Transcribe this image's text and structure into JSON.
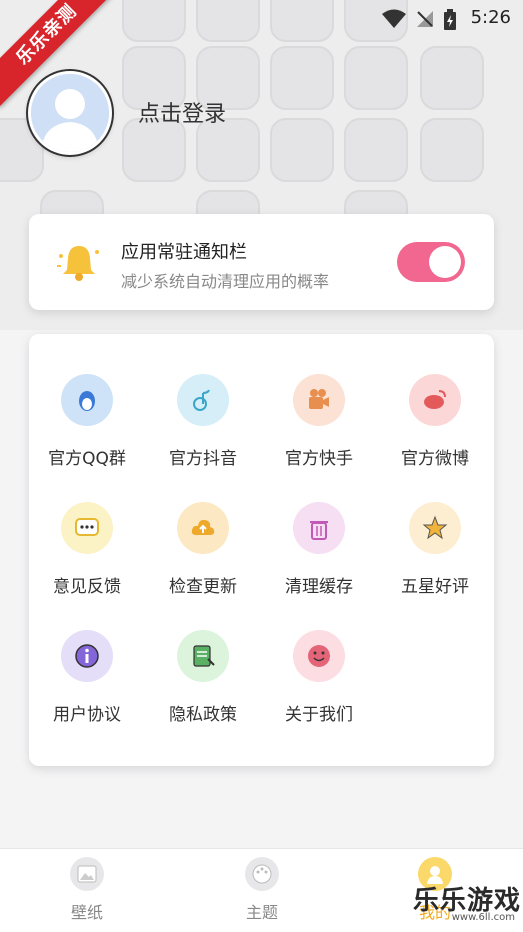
{
  "status_bar": {
    "time": "5:26"
  },
  "ribbon": {
    "text": "乐乐亲测"
  },
  "profile": {
    "login_text": "点击登录"
  },
  "notification": {
    "title": "应用常驻通知栏",
    "subtitle": "减少系统自动清理应用的概率",
    "toggle_on": true,
    "toggle_color": "#f1678f"
  },
  "grid": [
    {
      "label": "官方QQ群",
      "icon": "penguin-icon",
      "bg": "#cfe3f8",
      "fg": "#3a7ad6"
    },
    {
      "label": "官方抖音",
      "icon": "music-note-icon",
      "bg": "#d5eef8",
      "fg": "#3aa6c9"
    },
    {
      "label": "官方快手",
      "icon": "camera-icon",
      "bg": "#fbe2d4",
      "fg": "#e88f4f"
    },
    {
      "label": "官方微博",
      "icon": "weibo-icon",
      "bg": "#fbd7d7",
      "fg": "#e45a5a"
    },
    {
      "label": "意见反馈",
      "icon": "chat-bubble-icon",
      "bg": "#fbf3c6",
      "fg": "#e4b92f"
    },
    {
      "label": "检查更新",
      "icon": "cloud-upload-icon",
      "bg": "#fce9c3",
      "fg": "#efa92a"
    },
    {
      "label": "清理缓存",
      "icon": "trash-icon",
      "bg": "#f6dff3",
      "fg": "#c05ab6"
    },
    {
      "label": "五星好评",
      "icon": "star-icon",
      "bg": "#fdeed1",
      "fg": "#f0b33b"
    },
    {
      "label": "用户协议",
      "icon": "info-icon",
      "bg": "#e4def8",
      "fg": "#8466d8"
    },
    {
      "label": "隐私政策",
      "icon": "document-icon",
      "bg": "#dcf3dc",
      "fg": "#5ab063"
    },
    {
      "label": "关于我们",
      "icon": "smiley-icon",
      "bg": "#fcdde2",
      "fg": "#e46478"
    }
  ],
  "bottom_nav": [
    {
      "label": "壁纸",
      "icon": "wallpaper-icon"
    },
    {
      "label": "主题",
      "icon": "palette-icon"
    },
    {
      "label": "我的",
      "icon": "user-icon",
      "active": true
    }
  ],
  "watermark": {
    "text": "乐乐游戏",
    "url": "www.6ll.com"
  }
}
